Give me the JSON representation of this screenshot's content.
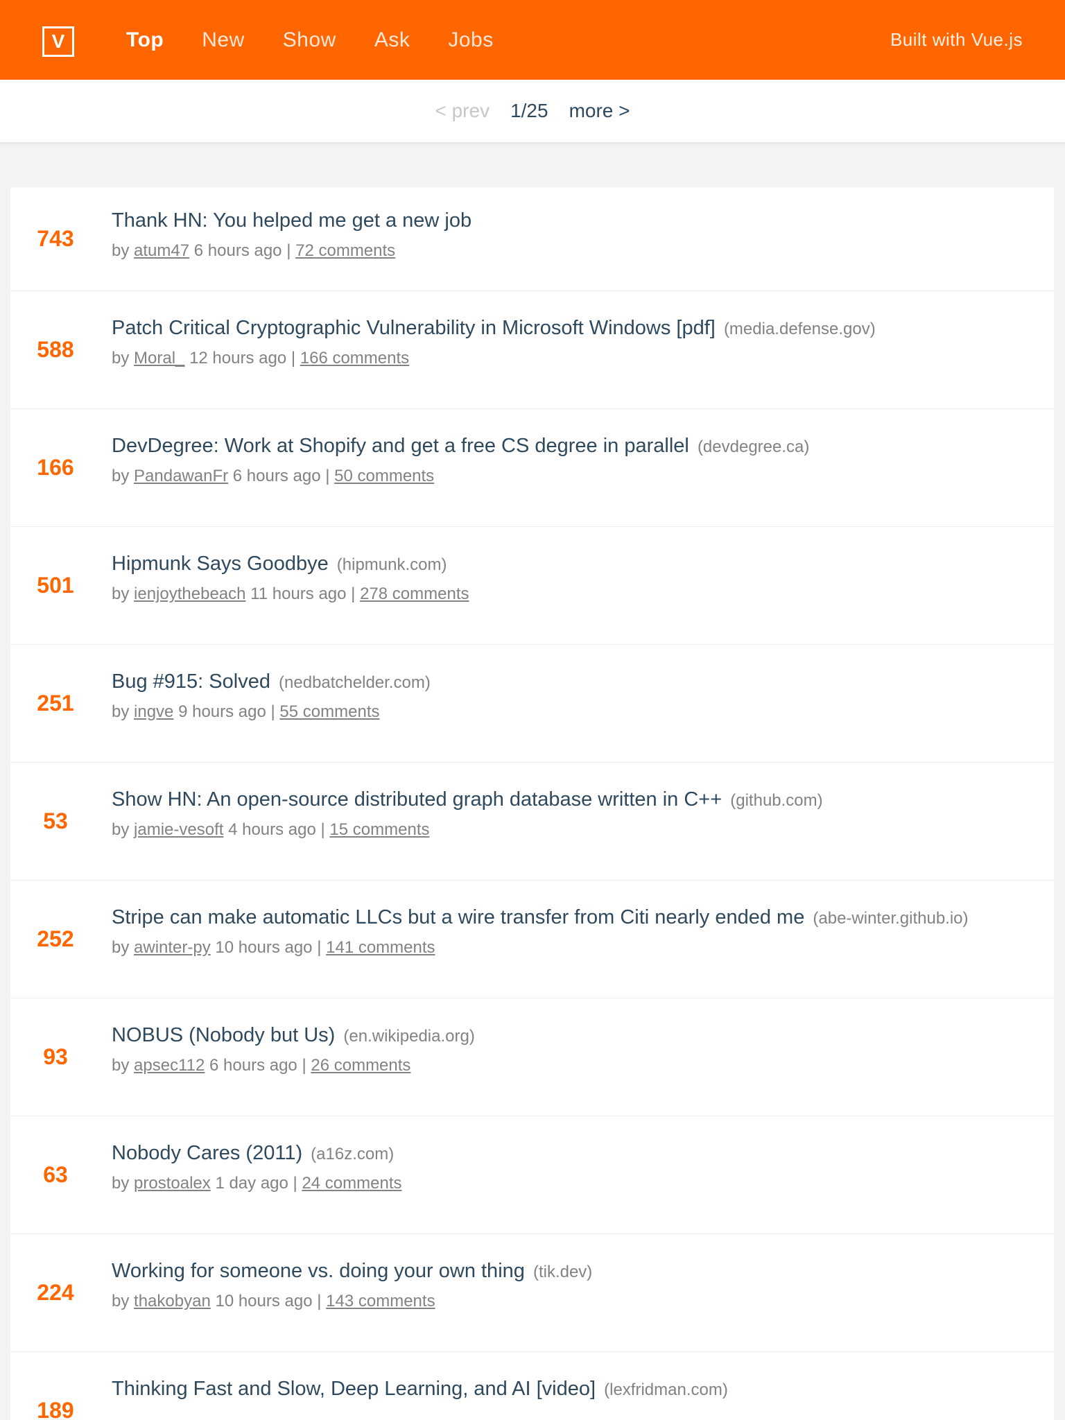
{
  "header": {
    "logo_text": "V",
    "nav": [
      {
        "label": "Top",
        "active": true
      },
      {
        "label": "New",
        "active": false
      },
      {
        "label": "Show",
        "active": false
      },
      {
        "label": "Ask",
        "active": false
      },
      {
        "label": "Jobs",
        "active": false
      }
    ],
    "built_with": "Built with Vue.js"
  },
  "pager": {
    "prev": "< prev",
    "position": "1/25",
    "more": "more >"
  },
  "items": [
    {
      "score": "743",
      "title": "Thank HN: You helped me get a new job",
      "host": "",
      "by": "by",
      "user": "atum47",
      "time": "6 hours ago |",
      "comments": "72 comments"
    },
    {
      "score": "588",
      "title": "Patch Critical Cryptographic Vulnerability in Microsoft Windows [pdf]",
      "host": "(media.defense.gov)",
      "by": "by",
      "user": "Moral_",
      "time": "12 hours ago |",
      "comments": "166 comments"
    },
    {
      "score": "166",
      "title": "DevDegree: Work at Shopify and get a free CS degree in parallel",
      "host": "(devdegree.ca)",
      "by": "by",
      "user": "PandawanFr",
      "time": "6 hours ago |",
      "comments": "50 comments"
    },
    {
      "score": "501",
      "title": "Hipmunk Says Goodbye",
      "host": "(hipmunk.com)",
      "by": "by",
      "user": "ienjoythebeach",
      "time": "11 hours ago |",
      "comments": "278 comments"
    },
    {
      "score": "251",
      "title": "Bug #915: Solved",
      "host": "(nedbatchelder.com)",
      "by": "by",
      "user": "ingve",
      "time": "9 hours ago |",
      "comments": "55 comments"
    },
    {
      "score": "53",
      "title": "Show HN: An open-source distributed graph database written in C++",
      "host": "(github.com)",
      "by": "by",
      "user": "jamie-vesoft",
      "time": "4 hours ago |",
      "comments": "15 comments"
    },
    {
      "score": "252",
      "title": "Stripe can make automatic LLCs but a wire transfer from Citi nearly ended me",
      "host": "(abe-winter.github.io)",
      "by": "by",
      "user": "awinter-py",
      "time": "10 hours ago |",
      "comments": "141 comments"
    },
    {
      "score": "93",
      "title": "NOBUS (Nobody but Us)",
      "host": "(en.wikipedia.org)",
      "by": "by",
      "user": "apsec112",
      "time": "6 hours ago |",
      "comments": "26 comments"
    },
    {
      "score": "63",
      "title": "Nobody Cares (2011)",
      "host": "(a16z.com)",
      "by": "by",
      "user": "prostoalex",
      "time": "1 day ago |",
      "comments": "24 comments"
    },
    {
      "score": "224",
      "title": "Working for someone vs. doing your own thing",
      "host": "(tik.dev)",
      "by": "by",
      "user": "thakobyan",
      "time": "10 hours ago |",
      "comments": "143 comments"
    },
    {
      "score": "189",
      "title": "Thinking Fast and Slow, Deep Learning, and AI [video]",
      "host": "(lexfridman.com)",
      "by": "",
      "user": "",
      "time": "",
      "comments": ""
    }
  ]
}
